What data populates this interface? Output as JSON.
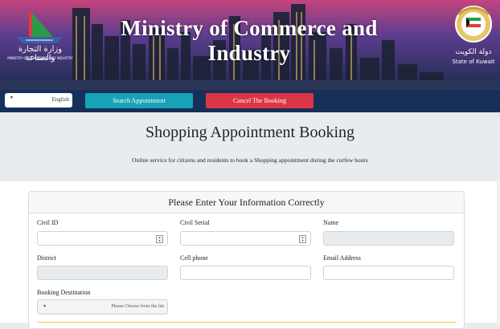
{
  "header": {
    "title": "Ministry of Commerce and Industry",
    "logo_left_ar": "وزارة التجارة والصناعة",
    "logo_left_en": "MINISTRY OF COMMERCE AND INDUSTRY",
    "logo_right_ar": "دولة الكويت",
    "logo_right_en": "State of Kuwait"
  },
  "nav": {
    "language": "English",
    "search_label": "Search Appointment",
    "cancel_label": "Cancel The Booking"
  },
  "intro": {
    "title": "Shopping Appointment Booking",
    "subtitle": "Online service for citizens and residents to book a Shopping appointment during the curfew hours"
  },
  "form": {
    "heading": "Please Enter Your Information Correctly",
    "civil_id_label": "Civil ID",
    "civil_serial_label": "Civil Serial",
    "name_label": "Name",
    "district_label": "District",
    "cell_phone_label": "Cell phone",
    "email_label": "Email Address",
    "destination_label": "Booking Destination",
    "destination_placeholder": "Please Choose from the list"
  },
  "colors": {
    "navbar": "#17305a",
    "search_button": "#17a2b8",
    "cancel_button": "#dc3545"
  }
}
